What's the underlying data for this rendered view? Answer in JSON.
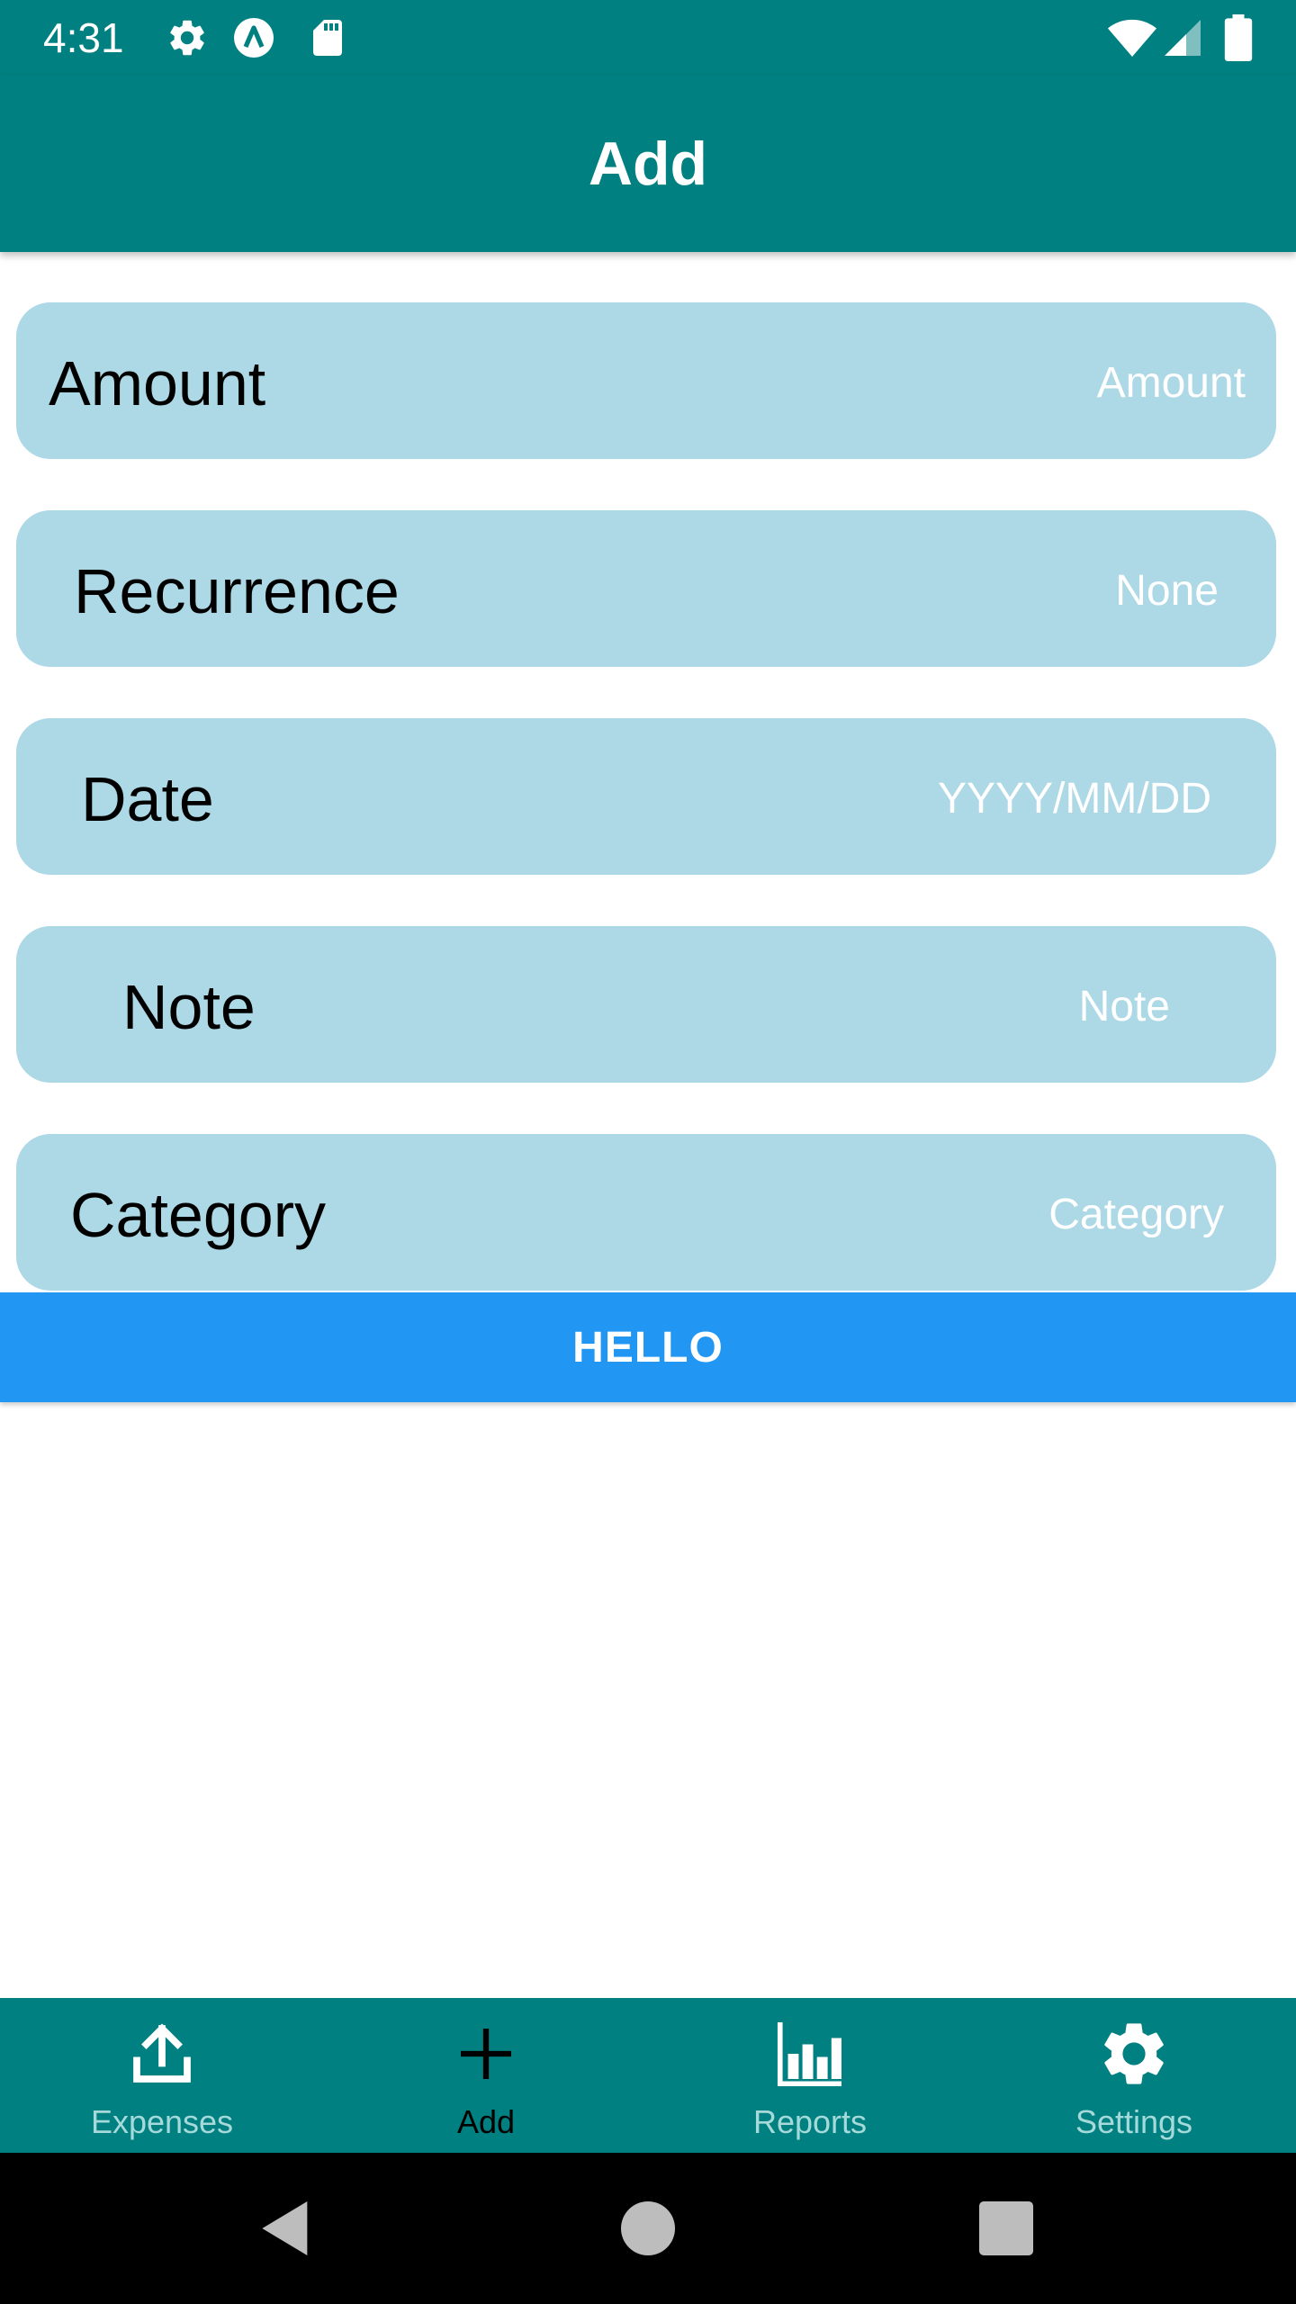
{
  "status_bar": {
    "time": "4:31",
    "icons": [
      "gear-icon",
      "a-circle-icon",
      "sd-card-icon",
      "wifi-icon",
      "signal-icon",
      "battery-icon"
    ]
  },
  "app_bar": {
    "title": "Add"
  },
  "form": {
    "amount": {
      "label": "Amount",
      "placeholder": "Amount"
    },
    "recurrence": {
      "label": "Recurrence",
      "value": "None"
    },
    "date": {
      "label": "Date",
      "placeholder": "YYYY/MM/DD"
    },
    "note": {
      "label": "Note",
      "placeholder": "Note"
    },
    "category": {
      "label": "Category",
      "placeholder": "Category"
    }
  },
  "hello_button": {
    "label": "HELLO"
  },
  "bottom_nav": {
    "tabs": [
      {
        "label": "Expenses",
        "icon": "upload-icon",
        "active": false
      },
      {
        "label": "Add",
        "icon": "plus-icon",
        "active": true
      },
      {
        "label": "Reports",
        "icon": "bar-chart-icon",
        "active": false
      },
      {
        "label": "Settings",
        "icon": "gear-icon",
        "active": false
      }
    ]
  },
  "system_nav": {
    "buttons": [
      "back-icon",
      "home-icon",
      "recents-icon"
    ]
  },
  "colors": {
    "primary": "#008080",
    "field_background": "#add8e6",
    "button": "#2196f3",
    "inactive_tab": "#a6d9d9"
  }
}
